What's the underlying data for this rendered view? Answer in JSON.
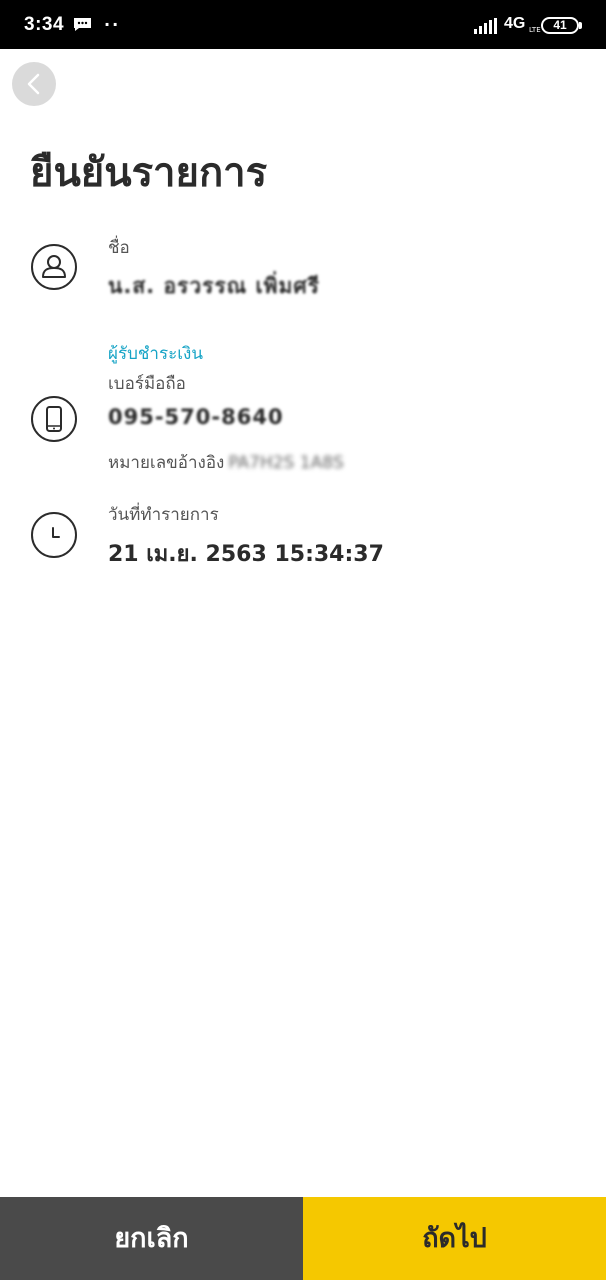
{
  "status_bar": {
    "time": "3:34",
    "dots": "··",
    "network": "4G",
    "lte": "LTE",
    "battery": "41"
  },
  "icons": {
    "back": "chevron-left-icon",
    "name": "user-icon",
    "phone": "phone-icon",
    "date": "clock-icon"
  },
  "page": {
    "title": "ยืนยันรายการ"
  },
  "recipient": {
    "name_label": "ชื่อ",
    "name_value": "น.ส. อรวรรณ เพิ่มศรี",
    "section_label": "ผู้รับชำระเงิน",
    "phone_label": "เบอร์มือถือ",
    "phone_value": "095-570-8640",
    "reference_label": "หมายเลขอ้างอิง",
    "reference_value": "PA7H2S 1A8S"
  },
  "transaction": {
    "date_label": "วันที่ทำรายการ",
    "date_value": "21 เม.ย. 2563 15:34:37"
  },
  "actions": {
    "cancel_label": "ยกเลิก",
    "next_label": "ถัดไป"
  },
  "colors": {
    "accent": "#17a4c6",
    "primary_button": "#f5c800",
    "secondary_button": "#4a4a4a"
  }
}
